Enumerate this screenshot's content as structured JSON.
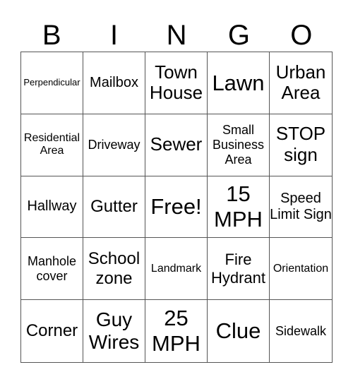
{
  "header": [
    "B",
    "I",
    "N",
    "G",
    "O"
  ],
  "cells": [
    "Perpendicular",
    "Mailbox",
    "Town House",
    "Lawn",
    "Urban Area",
    "Residential Area",
    "Driveway",
    "Sewer",
    "Small Business Area",
    "STOP sign",
    "Hallway",
    "Gutter",
    "Free!",
    "15 MPH",
    "Speed Limit Sign",
    "Manhole cover",
    "School zone",
    "Landmark",
    "Fire Hydrant",
    "Orientation",
    "Corner",
    "Guy Wires",
    "25 MPH",
    "Clue",
    "Sidewalk"
  ]
}
